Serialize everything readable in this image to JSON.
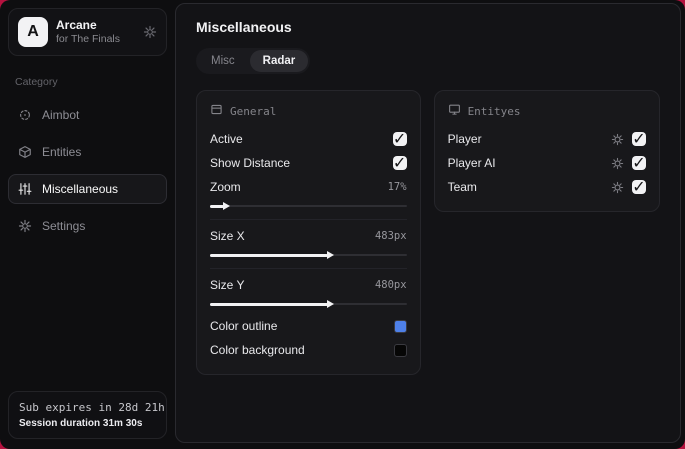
{
  "colors": {
    "backdrop_red": "#b5123f",
    "outline_swatch": "#4e80e8",
    "background_swatch": "#060606"
  },
  "sidebar": {
    "brand": {
      "logo_letter": "A",
      "title": "Arcane",
      "subtitle": "for The Finals"
    },
    "category_label": "Category",
    "items": [
      {
        "label": "Aimbot",
        "icon": "crosshair-icon",
        "selected": false
      },
      {
        "label": "Entities",
        "icon": "box-icon",
        "selected": false
      },
      {
        "label": "Miscellaneous",
        "icon": "sliders-icon",
        "selected": true
      },
      {
        "label": "Settings",
        "icon": "gear-icon",
        "selected": false
      }
    ],
    "footer": {
      "sub_expires": "Sub expires in 28d 21h",
      "session_duration": "Session duration 31m 30s"
    }
  },
  "main": {
    "title": "Miscellaneous",
    "tabs": [
      {
        "label": "Misc",
        "active": false
      },
      {
        "label": "Radar",
        "active": true
      }
    ],
    "panels": {
      "general": {
        "title": "General",
        "toggles": [
          {
            "label": "Active",
            "checked": true,
            "check_glyph": "✓"
          },
          {
            "label": "Show Distance",
            "checked": true,
            "check_glyph": "✓"
          }
        ],
        "sliders": [
          {
            "label": "Zoom",
            "value": "17%",
            "fill_pct": 7
          },
          {
            "label": "Size X",
            "value": "483px",
            "fill_pct": 60
          },
          {
            "label": "Size Y",
            "value": "480px",
            "fill_pct": 60
          }
        ],
        "color_rows": [
          {
            "label": "Color outline"
          },
          {
            "label": "Color background"
          }
        ]
      },
      "entities": {
        "title": "Entityes",
        "rows": [
          {
            "label": "Player",
            "checked": true,
            "check_glyph": "✓"
          },
          {
            "label": "Player AI",
            "checked": true,
            "check_glyph": "✓"
          },
          {
            "label": "Team",
            "checked": true,
            "check_glyph": "✓"
          }
        ]
      }
    }
  }
}
